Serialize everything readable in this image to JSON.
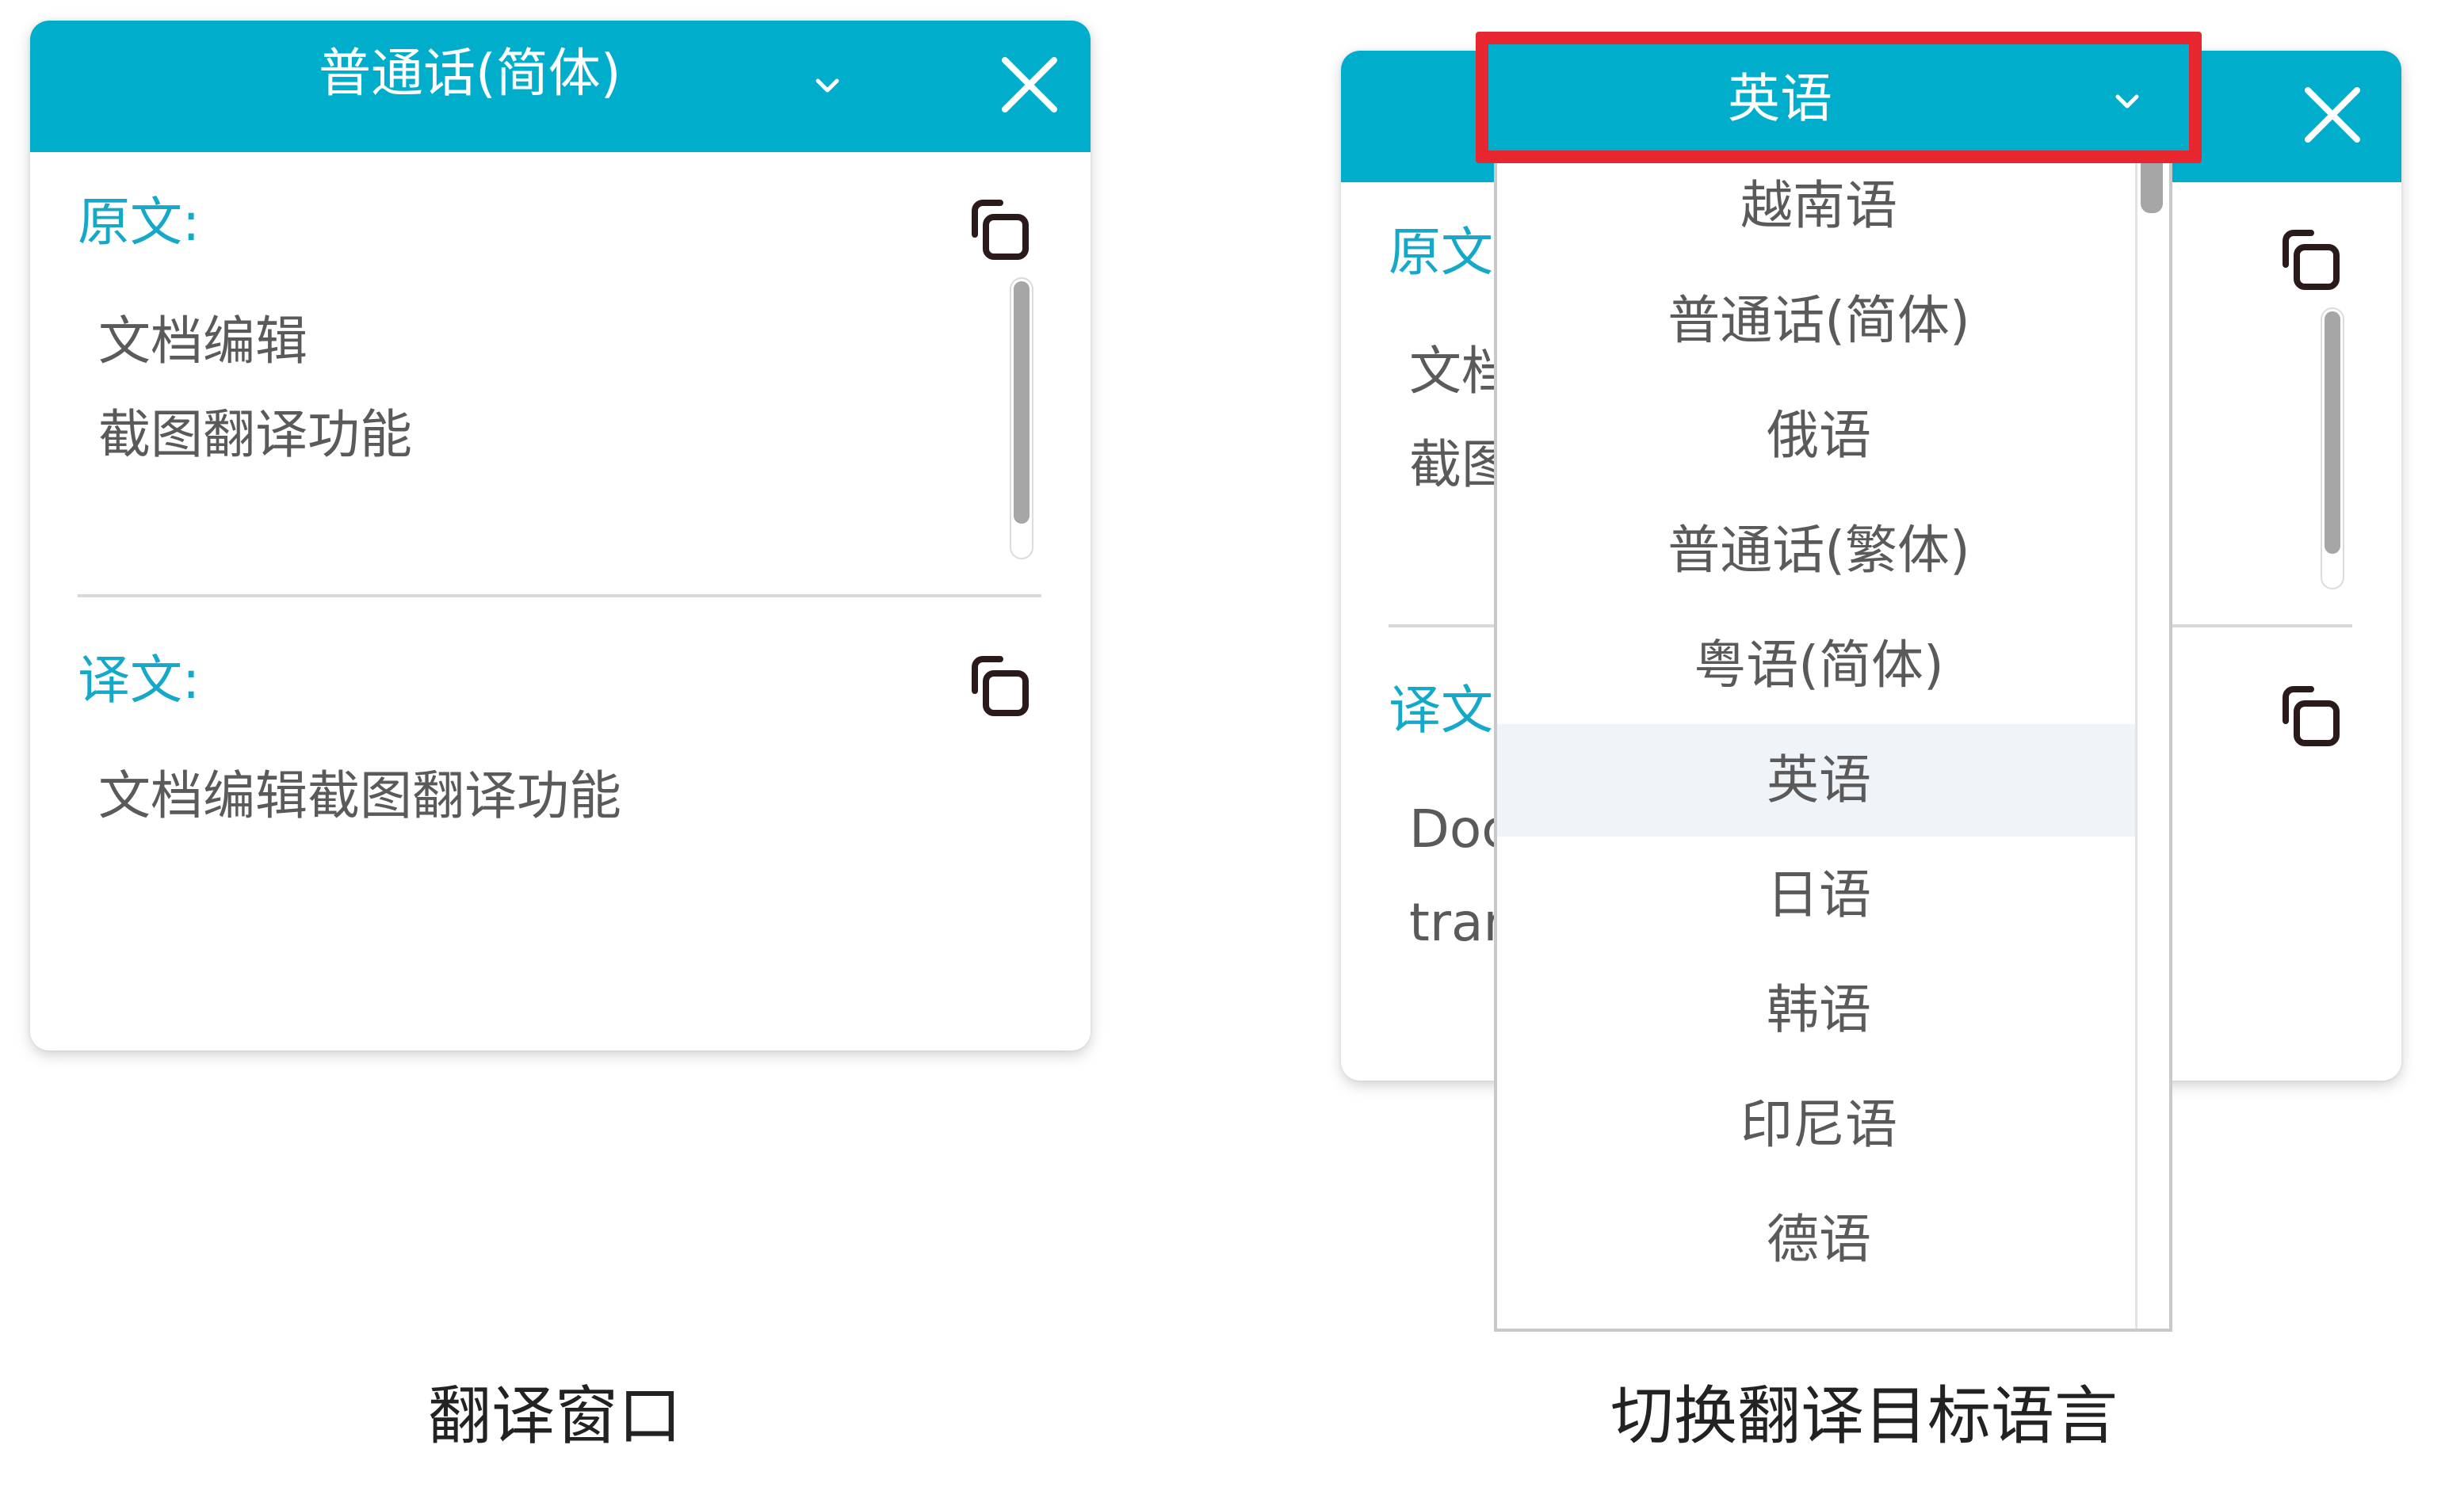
{
  "left_window": {
    "source_language": "普通话(简体)",
    "original_label": "原文:",
    "original_text": [
      "文档编辑",
      "截图翻译功能"
    ],
    "translation_label": "译文:",
    "translation_text": "文档编辑截图翻译功能",
    "scroll_position": 0.0
  },
  "right_window": {
    "target_language": "英语",
    "original_label_partial": "原文",
    "original_text_partial": [
      "文档",
      "截图"
    ],
    "translation_label_partial": "译文",
    "translation_text_partial": [
      "Doc",
      "tran"
    ]
  },
  "dropdown": {
    "options": [
      "越南语",
      "普通话(简体)",
      "俄语",
      "普通话(繁体)",
      "粤语(简体)",
      "英语",
      "日语",
      "韩语",
      "印尼语",
      "德语"
    ],
    "selected": "英语",
    "scroll_position": 0.0
  },
  "captions": {
    "left": "翻译窗口",
    "right": "切换翻译目标语言"
  },
  "colors": {
    "accent": "#00aecc",
    "label": "#14a9c9",
    "highlight": "#e8262f",
    "active_option_bg": "#eff4f9"
  },
  "icons": {
    "dropdown": "chevron-down-icon",
    "close": "close-icon",
    "copy": "copy-icon"
  }
}
